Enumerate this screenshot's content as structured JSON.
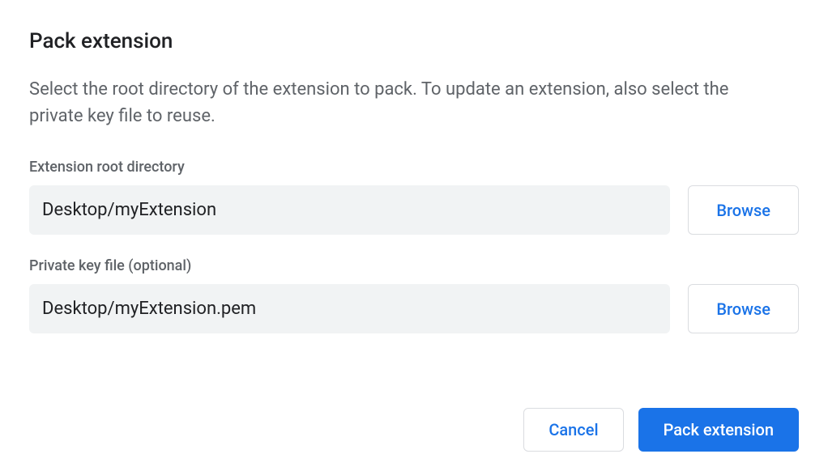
{
  "dialog": {
    "title": "Pack extension",
    "description": "Select the root directory of the extension to pack. To update an extension, also select the private key file to reuse."
  },
  "fields": {
    "rootDir": {
      "label": "Extension root directory",
      "value": "Desktop/myExtension",
      "browse": "Browse"
    },
    "privateKey": {
      "label": "Private key file (optional)",
      "value": "Desktop/myExtension.pem",
      "browse": "Browse"
    }
  },
  "actions": {
    "cancel": "Cancel",
    "pack": "Pack extension"
  },
  "colors": {
    "accent": "#1a73e8",
    "textPrimary": "#202124",
    "textSecondary": "#5f6368",
    "inputBg": "#f1f3f4",
    "border": "#dadce0"
  }
}
